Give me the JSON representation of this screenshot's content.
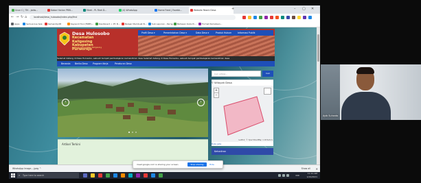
{
  "browser": {
    "tabs": [
      {
        "label": "Ucun C | TIK - jadw...",
        "color": "#4caf50"
      },
      {
        "label": "Kabar Harian PMN...",
        "color": "#e53935"
      },
      {
        "label": "Meet - PL Riah D...",
        "color": "#00897b"
      },
      {
        "label": "(4) WhatsApp",
        "color": "#25d366"
      },
      {
        "label": "Home Feed | Facebk...",
        "color": "#1877f2"
      },
      {
        "label": "Website Resmi Desa",
        "color": "#e53935"
      }
    ],
    "new_tab_label": "+",
    "window_controls": [
      "–",
      "▢",
      "✕"
    ],
    "url": "localhost/desa_hulosobo/index.php/first",
    "nav": {
      "back": "←",
      "forward": "→",
      "reload": "↻",
      "home": "⌂"
    },
    "extension_colors": [
      "#e53935",
      "#fbc02d",
      "#1e88e5",
      "#43a047",
      "#8e24aa",
      "#e53935",
      "#f4511e",
      "#00897b",
      "#3949ab",
      "#6d4c41",
      "#fdd835",
      "#5e35b1",
      "#1e88e5"
    ],
    "bookmarks": [
      {
        "label": "Apps",
        "color": "#5f6368"
      },
      {
        "label": "Semua kue tele",
        "color": "#1e88e5"
      },
      {
        "label": "Kemendipdtt",
        "color": "#e53935"
      },
      {
        "label": "Keyword Tool (FREE)...",
        "color": "#fb8c00"
      },
      {
        "label": "Dashboard < PT. B...",
        "color": "#43a047"
      },
      {
        "label": "Belajar Membuat B...",
        "color": "#e53935"
      },
      {
        "label": "Sub Laporan - Perng...",
        "color": "#1e88e5"
      },
      {
        "label": "Bahasan Kode Pi...",
        "color": "#43a047"
      },
      {
        "label": "Format Pemetaan...",
        "color": "#8e24aa"
      }
    ]
  },
  "site": {
    "name": "Desa Hulosobo",
    "subtitle_line1": "Kecamatan Kaligesing",
    "subtitle_line2": "Kabupaten Purworejo",
    "small_text": "Jl. Bagio Kecamatan Kaligesing",
    "top_nav": [
      "Profil Desa ▾",
      "Pemerintahan Desa ▾",
      "Data Desa ▾",
      "Produk Hukum",
      "Informasi Publik"
    ],
    "ticker": "Selamat datang di Desa Hulosobo, sebuah tempat pembelajaran kemandirian desa     Selamat datang di Desa Hulosobo, sebuah tempat pembelajaran kemandirian desa",
    "main_nav": [
      "Beranda",
      "Berita Desa",
      "Program Kerja",
      "Peraturan Desa"
    ],
    "slider_prev": "‹",
    "slider_next": "›",
    "artikel_title": "Artikel Terkini",
    "search_placeholder": "Cari artikel...",
    "search_button": "Cari",
    "wilayah_title": "Wilayah Desa",
    "map_zoom_in": "+",
    "map_zoom_out": "−",
    "map_attribution": "Leaflet | © OpenStreetMap contributors",
    "map_footer": "Buka peta",
    "kehadiran_title": "Kehadiran"
  },
  "downloads": {
    "item": "WhatsApp Image....jpeg",
    "item_arrow": "^",
    "show_all": "Show all",
    "close": "✕"
  },
  "sharebar": {
    "text": "meet.google.com is sharing your screen.",
    "stop_label": "Stop sharing",
    "hide_label": "Hide"
  },
  "taskbar": {
    "search_placeholder": "Type here to search",
    "search_icon": "⌕",
    "time": "11:11 AM",
    "date": "1/24/2021",
    "lang": "IND",
    "app_colors": [
      "#5c6bc0",
      "#ffca28",
      "#e53935",
      "#43a047",
      "#1e88e5",
      "#fb8c00",
      "#00acc1",
      "#8e24aa",
      "#e53935",
      "#1e88e5",
      "#43a047"
    ]
  },
  "webcam": {
    "name": "Ayib Suhanto"
  }
}
